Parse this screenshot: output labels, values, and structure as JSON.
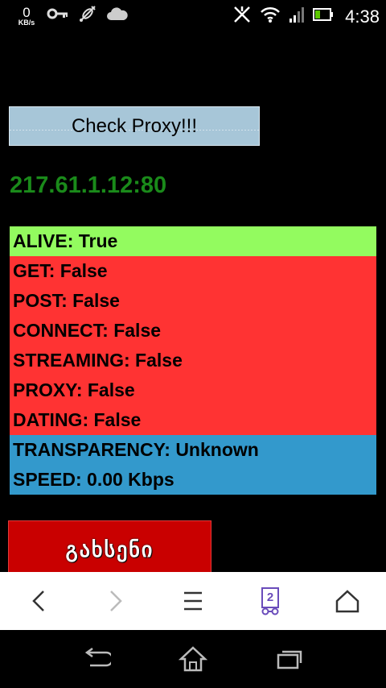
{
  "status_bar": {
    "data_rate_value": "0",
    "data_rate_unit": "KB/s",
    "time": "4:38"
  },
  "check_button": {
    "label": "Check Proxy!!!"
  },
  "proxy": {
    "address": "217.61.1.12:80"
  },
  "results": [
    {
      "label": "ALIVE: True",
      "color": "#93fb5f"
    },
    {
      "label": "GET: False",
      "color": "#ff3333"
    },
    {
      "label": "POST: False",
      "color": "#ff3333"
    },
    {
      "label": "CONNECT: False",
      "color": "#ff3333"
    },
    {
      "label": "STREAMING: False",
      "color": "#ff3333"
    },
    {
      "label": "PROXY: False",
      "color": "#ff3333"
    },
    {
      "label": "DATING: False",
      "color": "#ff3333"
    },
    {
      "label": "TRANSPARENCY: Unknown",
      "color": "#3399cc"
    },
    {
      "label": "SPEED: 0.00 Kbps",
      "color": "#3399cc"
    }
  ],
  "ad_button": {
    "label": "გახსენი"
  },
  "browser_toolbar": {
    "tab_count": "2"
  },
  "icons": [
    "key-icon",
    "satellite-icon",
    "cloud-icon",
    "no-signal-icon",
    "wifi-icon",
    "cell-signal-icon",
    "battery-icon",
    "back-arrow-icon",
    "forward-arrow-icon",
    "menu-icon",
    "tabs-icon",
    "home-icon",
    "nav-back-icon",
    "nav-home-icon",
    "nav-recents-icon"
  ]
}
